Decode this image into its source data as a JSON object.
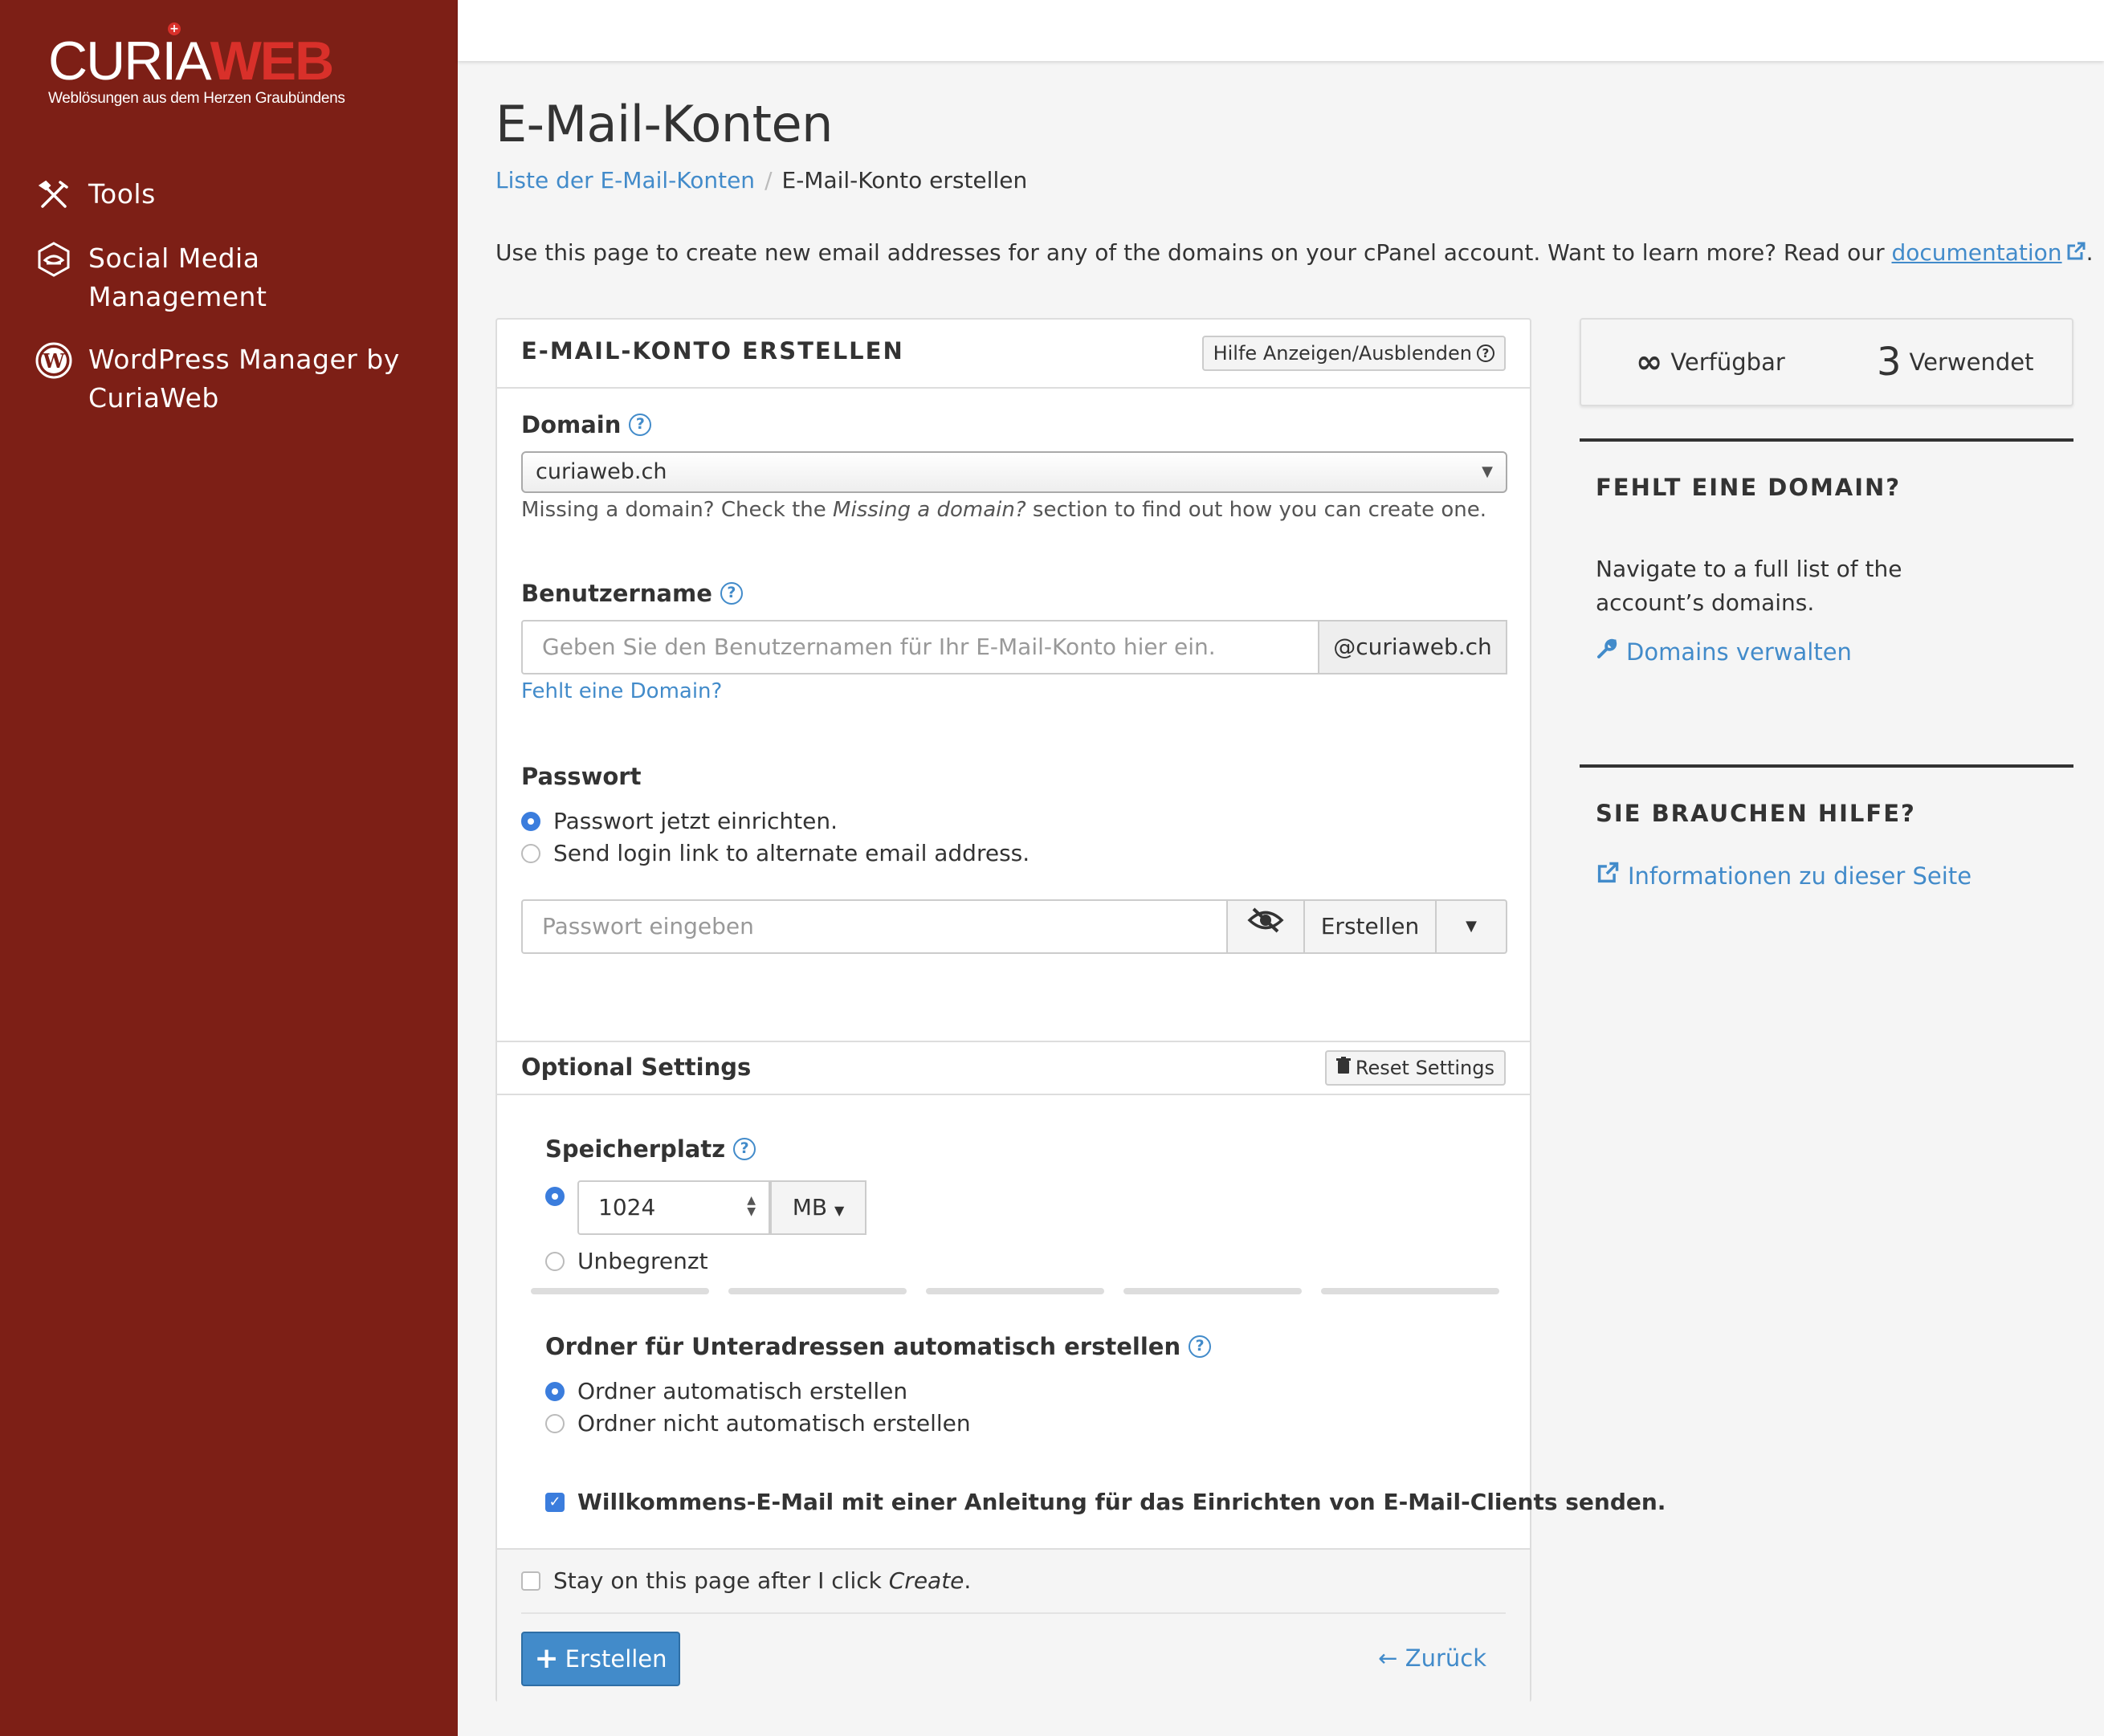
{
  "brand": {
    "name_part1": "CURIA",
    "name_part2": "WEB",
    "tagline": "Weblösungen aus dem Herzen Graubündens",
    "colors": {
      "sidebar": "#7d1f16",
      "accent": "#d9302a",
      "link": "#428bca"
    }
  },
  "sidebar": {
    "items": [
      {
        "label": "Tools",
        "icon": "tools-icon"
      },
      {
        "label": "Social Media Management",
        "icon": "social-media-icon"
      },
      {
        "label": "WordPress Manager by CuriaWeb",
        "icon": "wordpress-icon"
      }
    ]
  },
  "page": {
    "title": "E-Mail-Konten",
    "breadcrumb": {
      "link": "Liste der E-Mail-Konten",
      "separator": "/",
      "current": "E-Mail-Konto erstellen"
    },
    "intro": "Use this page to create new email addresses for any of the domains on your cPanel account. Want to learn more? Read our",
    "intro_link": "documentation",
    "intro_end": "."
  },
  "form": {
    "title": "E-MAIL-KONTO ERSTELLEN",
    "help_toggle": "Hilfe Anzeigen/Ausblenden",
    "domain": {
      "label": "Domain",
      "value": "curiaweb.ch",
      "help_prefix": "Missing a domain? Check the ",
      "help_em": "Missing a domain?",
      "help_suffix": " section to find out how you can create one."
    },
    "username": {
      "label": "Benutzername",
      "placeholder": "Geben Sie den Benutzernamen für Ihr E-Mail-Konto hier ein.",
      "suffix": "@curiaweb.ch",
      "missing_link": "Fehlt eine Domain?"
    },
    "password": {
      "label": "Passwort",
      "options": [
        "Passwort jetzt einrichten.",
        "Send login link to alternate email address."
      ],
      "selected": 0,
      "placeholder": "Passwort eingeben",
      "generate": "Erstellen",
      "strength_segments": 5
    },
    "optional": {
      "title": "Optional Settings",
      "reset": "Reset Settings",
      "storage": {
        "label": "Speicherplatz",
        "value": "1024",
        "unit": "MB",
        "unlimited": "Unbegrenzt",
        "selected": "value"
      },
      "subaddress": {
        "label": "Ordner für Unteradressen automatisch erstellen",
        "options": [
          "Ordner automatisch erstellen",
          "Ordner nicht automatisch erstellen"
        ],
        "selected": 0
      },
      "welcome_email": {
        "label": "Willkommens-E-Mail mit einer Anleitung für das Einrichten von E-Mail-Clients senden.",
        "checked": true
      }
    },
    "stay_prefix": "Stay on this page after I click ",
    "stay_em": "Create",
    "stay_suffix": ".",
    "stay_checked": false,
    "submit": "Erstellen",
    "back": "Zurück"
  },
  "stats": {
    "available_symbol": "∞",
    "available_label": "Verfügbar",
    "used_count": "3",
    "used_label": "Verwendet"
  },
  "side": {
    "missing_domain": {
      "title": "FEHLT EINE DOMAIN?",
      "text": "Navigate to a full list of the account’s domains.",
      "link": "Domains verwalten"
    },
    "help": {
      "title": "SIE BRAUCHEN HILFE?",
      "link": "Informationen zu dieser Seite"
    }
  }
}
